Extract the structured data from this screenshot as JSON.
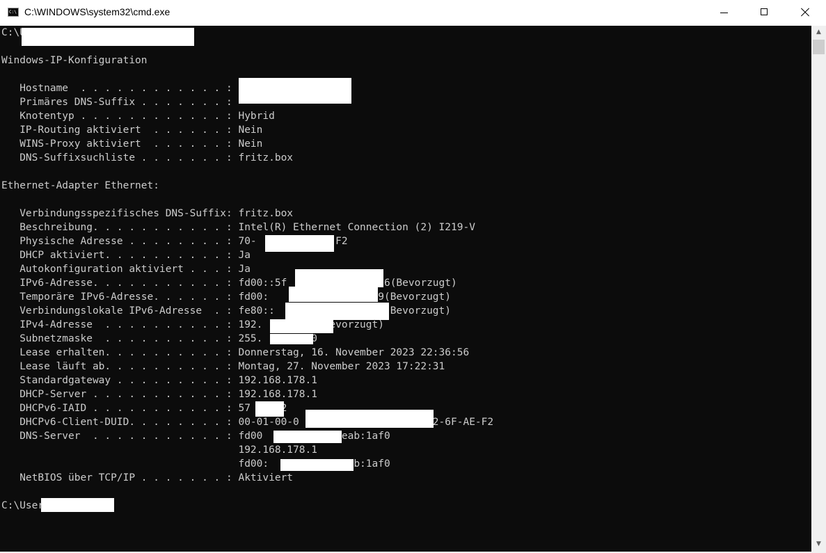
{
  "window": {
    "title": "C:\\WINDOWS\\system32\\cmd.exe",
    "icon": "cmd-app-icon",
    "icon_glyph": "C:\\"
  },
  "console_lines": [
    "C:\\U",
    "",
    "Windows-IP-Konfiguration",
    "",
    "   Hostname  . . . . . . . . . . . . :",
    "   Primäres DNS-Suffix . . . . . . . :",
    "   Knotentyp . . . . . . . . . . . . : Hybrid",
    "   IP-Routing aktiviert  . . . . . . : Nein",
    "   WINS-Proxy aktiviert  . . . . . . : Nein",
    "   DNS-Suffixsuchliste . . . . . . . : fritz.box",
    "",
    "Ethernet-Adapter Ethernet:",
    "",
    "   Verbindungsspezifisches DNS-Suffix: fritz.box",
    "   Beschreibung. . . . . . . . . . . : Intel(R) Ethernet Connection (2) I219-V",
    "   Physische Adresse . . . . . . . . : 70-            -F2",
    "   DHCP aktiviert. . . . . . . . . . : Ja",
    "   Autokonfiguration aktiviert . . . : Ja",
    "   IPv6-Adresse. . . . . . . . . . . : fd00::5f              886(Bevorzugt)",
    "   Temporäre IPv6-Adresse. . . . . . : fd00:                2d9(Bevorzugt)",
    "   Verbindungslokale IPv6-Adresse  . : fe80::              d%14(Bevorzugt)",
    "   IPv4-Adresse  . . . . . . . . . . : 192.         (Bevorzugt)",
    "   Subnetzmaske  . . . . . . . . . . : 255.       .0",
    "   Lease erhalten. . . . . . . . . . : Donnerstag, 16. November 2023 22:36:56",
    "   Lease läuft ab. . . . . . . . . . : Montag, 27. November 2023 17:22:31",
    "   Standardgateway . . . . . . . . . : 192.168.178.1",
    "   DHCP-Server . . . . . . . . . . . : 192.168.178.1",
    "   DHCPv6-IAID . . . . . . . . . . . : 57    22",
    "   DHCPv6-Client-DUID. . . . . . . . : 00-01-00-0                     C2-6F-AE-F2",
    "   DNS-Server  . . . . . . . . . . . : fd00           :feab:1af0",
    "                                       192.168.178.1",
    "                                       fd00:            eab:1af0",
    "   NetBIOS über TCP/IP . . . . . . . : Aktiviert",
    "",
    "C:\\User"
  ]
}
